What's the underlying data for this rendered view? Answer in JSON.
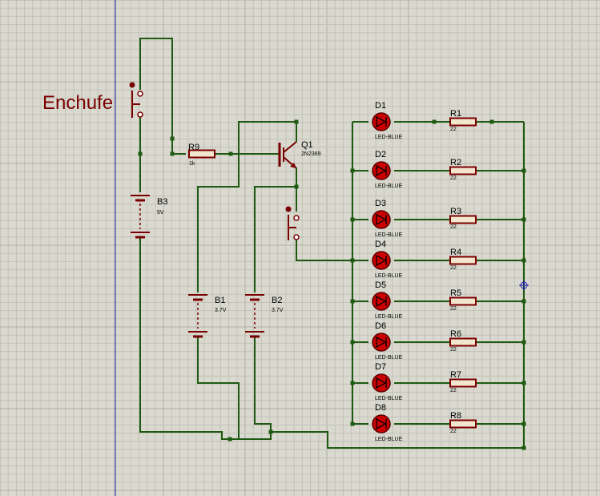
{
  "title": "Enchufe",
  "colors": {
    "background": "#d9d9cf",
    "grid_minor": "#c2c2b8",
    "grid_major": "#b0b0a6",
    "wire": "#1f5a12",
    "component": "#7a0000",
    "led_fill": "#cc0000",
    "label": "#000000",
    "axis": "#1a1aa8"
  },
  "components": {
    "R9": {
      "ref": "R9",
      "value": "1k"
    },
    "Q1": {
      "ref": "Q1",
      "value": "2N2369"
    },
    "B3": {
      "ref": "B3",
      "value": "5V"
    },
    "B1": {
      "ref": "B1",
      "value": "3.7V"
    },
    "B2": {
      "ref": "B2",
      "value": "3.7V"
    }
  },
  "leds": [
    {
      "ref": "D1",
      "value": "LED-BLUE"
    },
    {
      "ref": "D2",
      "value": "LED-BLUE"
    },
    {
      "ref": "D3",
      "value": "LED-BLUE"
    },
    {
      "ref": "D4",
      "value": "LED-BLUE"
    },
    {
      "ref": "D5",
      "value": "LED-BLUE"
    },
    {
      "ref": "D6",
      "value": "LED-BLUE"
    },
    {
      "ref": "D7",
      "value": "LED-BLUE"
    },
    {
      "ref": "D8",
      "value": "LED-BLUE"
    }
  ],
  "resistors": [
    {
      "ref": "R1",
      "value": "22"
    },
    {
      "ref": "R2",
      "value": "22"
    },
    {
      "ref": "R3",
      "value": "22"
    },
    {
      "ref": "R4",
      "value": "22"
    },
    {
      "ref": "R5",
      "value": "22"
    },
    {
      "ref": "R6",
      "value": "22"
    },
    {
      "ref": "R7",
      "value": "22"
    },
    {
      "ref": "R8",
      "value": "22"
    }
  ]
}
